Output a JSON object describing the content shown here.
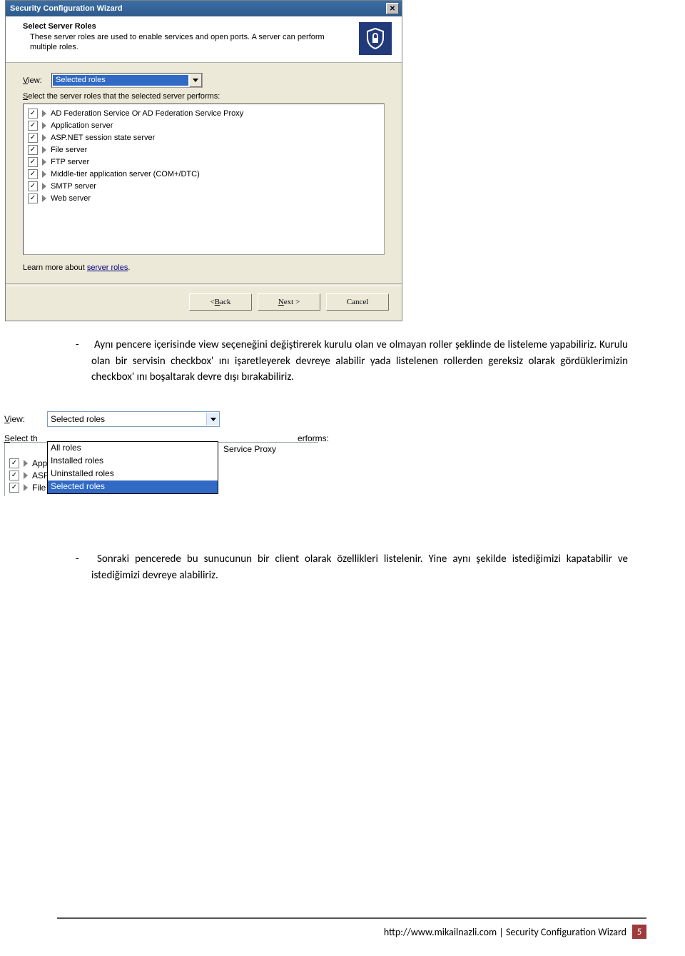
{
  "wizard": {
    "title": "Security Configuration Wizard",
    "header_title": "Select Server Roles",
    "header_sub": "These server roles are used to enable services and open ports. A server can perform multiple roles.",
    "view_label": "View:",
    "view_value": "Selected roles",
    "select_instruction": "Select the server roles that the selected server performs:",
    "roles": [
      "AD Federation Service Or AD Federation Service Proxy",
      "Application server",
      "ASP.NET session state server",
      "File server",
      "FTP server",
      "Middle-tier application server (COM+/DTC)",
      "SMTP server",
      "Web server"
    ],
    "learn_prefix": "Learn more about ",
    "learn_link": "server roles",
    "btn_back": "< Back",
    "btn_next": "Next >",
    "btn_cancel": "Cancel"
  },
  "paragraph1": "Aynı pencere içerisinde view seçeneğini değiştirerek kurulu olan ve olmayan roller şeklinde de listeleme yapabiliriz. Kurulu olan bir servisin checkbox' ını işaretleyerek devreye alabilir yada listelenen rollerden gereksiz olarak gördüklerimizin checkbox' ını boşaltarak devre dışı bırakabiliriz.",
  "wiz2": {
    "view_label": "View:",
    "view_value": "Selected roles",
    "select_prefix": "Select th",
    "select_suffix": "erforms:",
    "options": [
      "All roles",
      "Installed roles",
      "Uninstalled roles",
      "Selected roles"
    ],
    "selected_option_index": 3,
    "svc_proxy_text": "Service Proxy",
    "bg_roles": [
      "Application server",
      "ASP.NET session state server",
      "File server"
    ]
  },
  "paragraph2": "Sonraki pencerede bu sunucunun bir client olarak özellikleri listelenir. Yine aynı şekilde istediğimizi kapatabilir ve istediğimizi devreye alabiliriz.",
  "footer": {
    "url": "http://www.mikailnazli.com",
    "sep": " | ",
    "doc_title": "Security Configuration Wizard",
    "page_num": "5"
  }
}
